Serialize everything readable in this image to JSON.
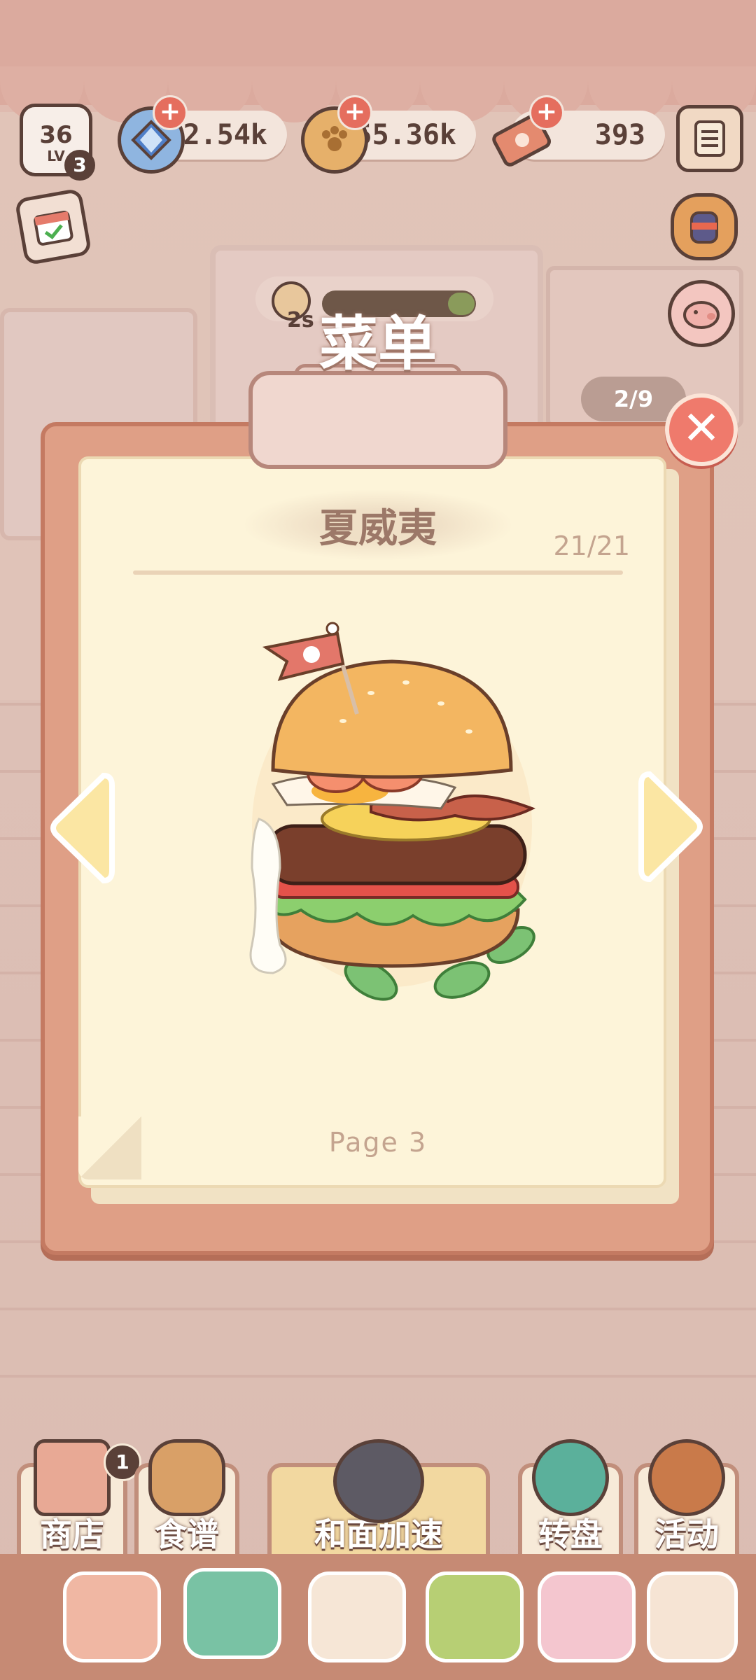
{
  "hud": {
    "level": "36",
    "level_label": "LV",
    "level_badge": "3",
    "gems": "12.54k",
    "coins": "155.36k",
    "tickets": "393"
  },
  "timer": {
    "text": "2s",
    "progress": 0.15
  },
  "menu": {
    "title": "菜单",
    "page_counter": "2/9",
    "dish_name": "夏威夷",
    "dish_count": "21/21",
    "page_label": "Page 3"
  },
  "bottom_tabs": [
    {
      "label": "商店",
      "badge": "1"
    },
    {
      "label": "食谱"
    },
    {
      "label": "和面加速"
    },
    {
      "label": "转盘"
    },
    {
      "label": "活动"
    }
  ],
  "colors": {
    "accent": "#df9f86",
    "paper": "#fdf4d9",
    "close": "#ef7a6c",
    "arrow": "#fbe6a3",
    "text_dark": "#5a4038"
  },
  "icons": {
    "level": "chef-hat-icon",
    "gems": "gem-icon",
    "coins": "paw-coin-icon",
    "tickets": "ticket-icon",
    "calendar": "calendar-icon",
    "jar": "jar-icon",
    "piggy": "piggy-bank-icon",
    "notes": "notebook-icon",
    "dish": "hamburger-icon"
  }
}
